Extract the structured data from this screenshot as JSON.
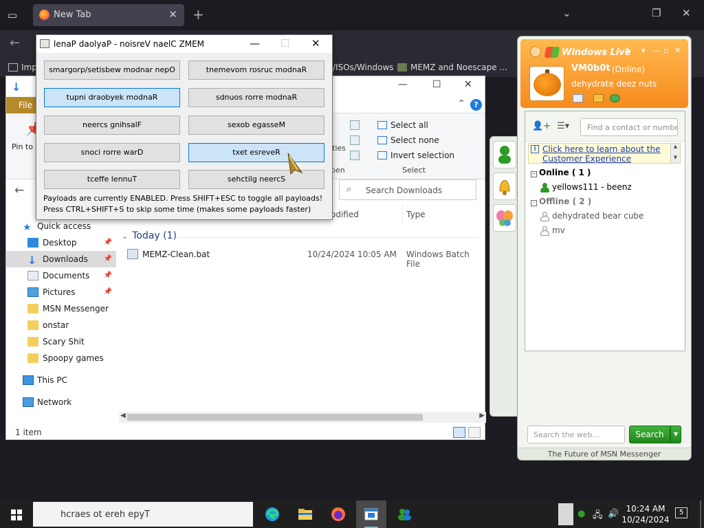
{
  "browser": {
    "tab_title": "New Tab",
    "bookmarks": [
      "Imp",
      "/ISOs/Windows",
      "MEMZ and Noescape ..."
    ]
  },
  "explorer": {
    "ribbon_file_tab": "File",
    "pin_label": "Pin to Quick access",
    "select_all": "Select all",
    "select_none": "Select none",
    "invert_selection": "Invert selection",
    "group_select": "Select",
    "group_open": "pen",
    "properties_partial": "ties",
    "search_placeholder": "Search Downloads",
    "col_modified": "odified",
    "col_type": "Type",
    "group_today": "Today (1)",
    "files": [
      {
        "name": "MEMZ-Clean.bat",
        "date": "10/24/2024 10:05 AM",
        "type": "Windows Batch File"
      }
    ],
    "status_count": "1 item",
    "nav": {
      "quick_access": "Quick access",
      "items": [
        "Desktop",
        "Downloads",
        "Documents",
        "Pictures",
        "MSN Messenger",
        "onstar",
        "Scary Shit",
        "Spoopy games"
      ],
      "this_pc": "This PC",
      "network": "Network"
    }
  },
  "memz": {
    "title": "lenaP daolyaP - noisreV naelC ZMEM",
    "buttons": [
      {
        "label": "smargorp/setisbew modnar nepO",
        "active": false
      },
      {
        "label": "tnemevom rosruc modnaR",
        "active": false
      },
      {
        "label": "tupni draobyek modnaR",
        "active": true
      },
      {
        "label": "sdnuos rorre modnaR",
        "active": false
      },
      {
        "label": "neercs gnihsalF",
        "active": false
      },
      {
        "label": "sexob egasseM",
        "active": false
      },
      {
        "label": "snoci rorre warD",
        "active": false
      },
      {
        "label": "txet esreveR",
        "active": true
      },
      {
        "label": "tceffe lennuT",
        "active": false
      },
      {
        "label": "sehctilg neercS",
        "active": false
      }
    ],
    "note_line1": "Payloads are currently ENABLED. Press SHIFT+ESC to toggle all payloads!",
    "note_line2": "Press CTRL+SHIFT+S to skip some time (makes some payloads faster)"
  },
  "msn": {
    "brand": "Windows Live",
    "username": "VM0b0t",
    "status": "(Online)",
    "personal_message": "dehydrate deez nuts",
    "find_placeholder": "Find a contact or number",
    "banner": "Click here to learn about the Customer Experience",
    "group_online": "Online ( 1 )",
    "group_offline": "Offline ( 2 )",
    "online_contacts": [
      "yellows111 - beenz"
    ],
    "offline_contacts": [
      "dehydrated bear cube",
      "mv"
    ],
    "web_search_placeholder": "Search the web...",
    "search_button": "Search",
    "footer": "The Future of MSN Messenger"
  },
  "taskbar": {
    "search_text": "hcraes ot ereh epyT",
    "time": "10:24 AM",
    "date": "10/24/2024",
    "notification_count": "5"
  }
}
